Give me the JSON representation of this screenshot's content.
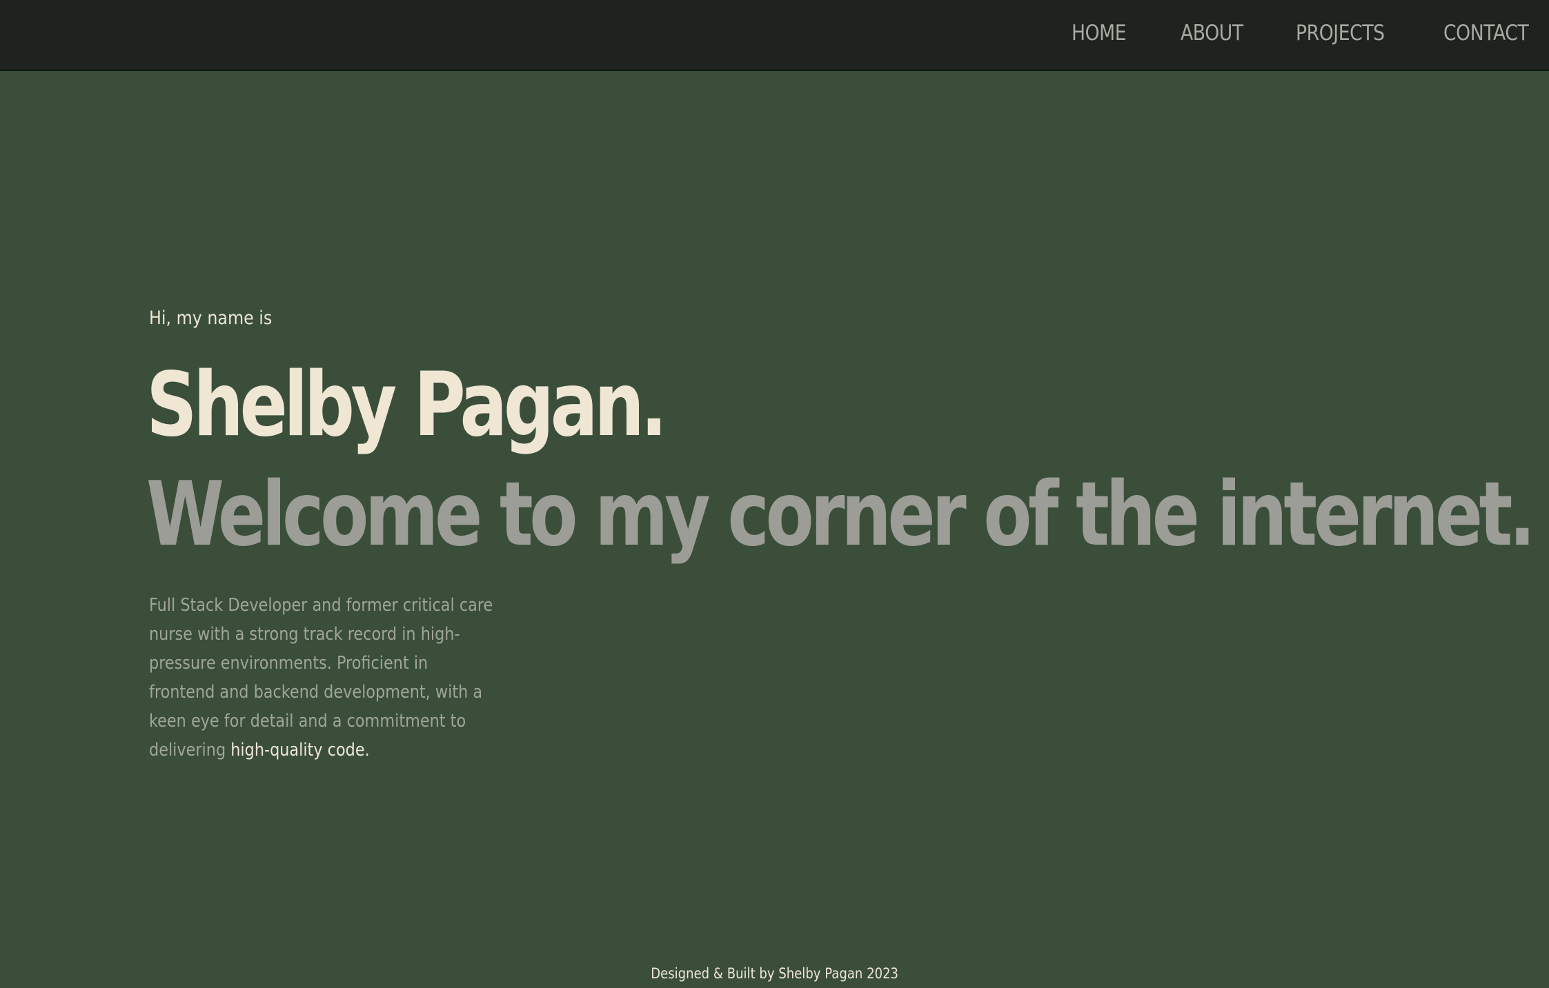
{
  "nav": {
    "items": [
      {
        "label": "HOME"
      },
      {
        "label": "ABOUT"
      },
      {
        "label": "PROJECTS"
      },
      {
        "label": "CONTACT"
      }
    ]
  },
  "hero": {
    "greeting": "Hi, my name is",
    "name": "Shelby Pagan.",
    "tagline": "Welcome to my corner of the internet.",
    "bio_text": "Full Stack Developer and former critical care nurse with a strong track record in high-pressure environments. Proficient in frontend and backend development, with a keen eye for detail and a commitment to delivering",
    "bio_highlight": "high-quality code."
  },
  "footer": {
    "text": "Designed & Built by Shelby Pagan 2023"
  },
  "colors": {
    "background": "#3a4e3a",
    "navbar": "#1f231f",
    "cream": "#efe6d4",
    "muted": "#9b9d96"
  }
}
